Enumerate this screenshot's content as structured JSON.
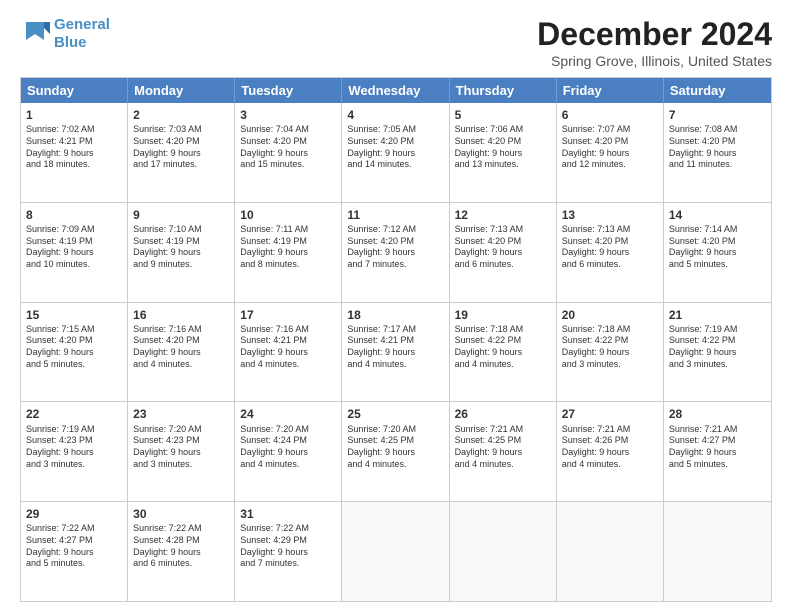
{
  "logo": {
    "line1": "General",
    "line2": "Blue"
  },
  "title": "December 2024",
  "location": "Spring Grove, Illinois, United States",
  "header_days": [
    "Sunday",
    "Monday",
    "Tuesday",
    "Wednesday",
    "Thursday",
    "Friday",
    "Saturday"
  ],
  "weeks": [
    [
      {
        "day": "1",
        "info": "Sunrise: 7:02 AM\nSunset: 4:21 PM\nDaylight: 9 hours\nand 18 minutes."
      },
      {
        "day": "2",
        "info": "Sunrise: 7:03 AM\nSunset: 4:20 PM\nDaylight: 9 hours\nand 17 minutes."
      },
      {
        "day": "3",
        "info": "Sunrise: 7:04 AM\nSunset: 4:20 PM\nDaylight: 9 hours\nand 15 minutes."
      },
      {
        "day": "4",
        "info": "Sunrise: 7:05 AM\nSunset: 4:20 PM\nDaylight: 9 hours\nand 14 minutes."
      },
      {
        "day": "5",
        "info": "Sunrise: 7:06 AM\nSunset: 4:20 PM\nDaylight: 9 hours\nand 13 minutes."
      },
      {
        "day": "6",
        "info": "Sunrise: 7:07 AM\nSunset: 4:20 PM\nDaylight: 9 hours\nand 12 minutes."
      },
      {
        "day": "7",
        "info": "Sunrise: 7:08 AM\nSunset: 4:20 PM\nDaylight: 9 hours\nand 11 minutes."
      }
    ],
    [
      {
        "day": "8",
        "info": "Sunrise: 7:09 AM\nSunset: 4:19 PM\nDaylight: 9 hours\nand 10 minutes."
      },
      {
        "day": "9",
        "info": "Sunrise: 7:10 AM\nSunset: 4:19 PM\nDaylight: 9 hours\nand 9 minutes."
      },
      {
        "day": "10",
        "info": "Sunrise: 7:11 AM\nSunset: 4:19 PM\nDaylight: 9 hours\nand 8 minutes."
      },
      {
        "day": "11",
        "info": "Sunrise: 7:12 AM\nSunset: 4:20 PM\nDaylight: 9 hours\nand 7 minutes."
      },
      {
        "day": "12",
        "info": "Sunrise: 7:13 AM\nSunset: 4:20 PM\nDaylight: 9 hours\nand 6 minutes."
      },
      {
        "day": "13",
        "info": "Sunrise: 7:13 AM\nSunset: 4:20 PM\nDaylight: 9 hours\nand 6 minutes."
      },
      {
        "day": "14",
        "info": "Sunrise: 7:14 AM\nSunset: 4:20 PM\nDaylight: 9 hours\nand 5 minutes."
      }
    ],
    [
      {
        "day": "15",
        "info": "Sunrise: 7:15 AM\nSunset: 4:20 PM\nDaylight: 9 hours\nand 5 minutes."
      },
      {
        "day": "16",
        "info": "Sunrise: 7:16 AM\nSunset: 4:20 PM\nDaylight: 9 hours\nand 4 minutes."
      },
      {
        "day": "17",
        "info": "Sunrise: 7:16 AM\nSunset: 4:21 PM\nDaylight: 9 hours\nand 4 minutes."
      },
      {
        "day": "18",
        "info": "Sunrise: 7:17 AM\nSunset: 4:21 PM\nDaylight: 9 hours\nand 4 minutes."
      },
      {
        "day": "19",
        "info": "Sunrise: 7:18 AM\nSunset: 4:22 PM\nDaylight: 9 hours\nand 4 minutes."
      },
      {
        "day": "20",
        "info": "Sunrise: 7:18 AM\nSunset: 4:22 PM\nDaylight: 9 hours\nand 3 minutes."
      },
      {
        "day": "21",
        "info": "Sunrise: 7:19 AM\nSunset: 4:22 PM\nDaylight: 9 hours\nand 3 minutes."
      }
    ],
    [
      {
        "day": "22",
        "info": "Sunrise: 7:19 AM\nSunset: 4:23 PM\nDaylight: 9 hours\nand 3 minutes."
      },
      {
        "day": "23",
        "info": "Sunrise: 7:20 AM\nSunset: 4:23 PM\nDaylight: 9 hours\nand 3 minutes."
      },
      {
        "day": "24",
        "info": "Sunrise: 7:20 AM\nSunset: 4:24 PM\nDaylight: 9 hours\nand 4 minutes."
      },
      {
        "day": "25",
        "info": "Sunrise: 7:20 AM\nSunset: 4:25 PM\nDaylight: 9 hours\nand 4 minutes."
      },
      {
        "day": "26",
        "info": "Sunrise: 7:21 AM\nSunset: 4:25 PM\nDaylight: 9 hours\nand 4 minutes."
      },
      {
        "day": "27",
        "info": "Sunrise: 7:21 AM\nSunset: 4:26 PM\nDaylight: 9 hours\nand 4 minutes."
      },
      {
        "day": "28",
        "info": "Sunrise: 7:21 AM\nSunset: 4:27 PM\nDaylight: 9 hours\nand 5 minutes."
      }
    ],
    [
      {
        "day": "29",
        "info": "Sunrise: 7:22 AM\nSunset: 4:27 PM\nDaylight: 9 hours\nand 5 minutes."
      },
      {
        "day": "30",
        "info": "Sunrise: 7:22 AM\nSunset: 4:28 PM\nDaylight: 9 hours\nand 6 minutes."
      },
      {
        "day": "31",
        "info": "Sunrise: 7:22 AM\nSunset: 4:29 PM\nDaylight: 9 hours\nand 7 minutes."
      },
      {
        "day": "",
        "info": ""
      },
      {
        "day": "",
        "info": ""
      },
      {
        "day": "",
        "info": ""
      },
      {
        "day": "",
        "info": ""
      }
    ]
  ]
}
